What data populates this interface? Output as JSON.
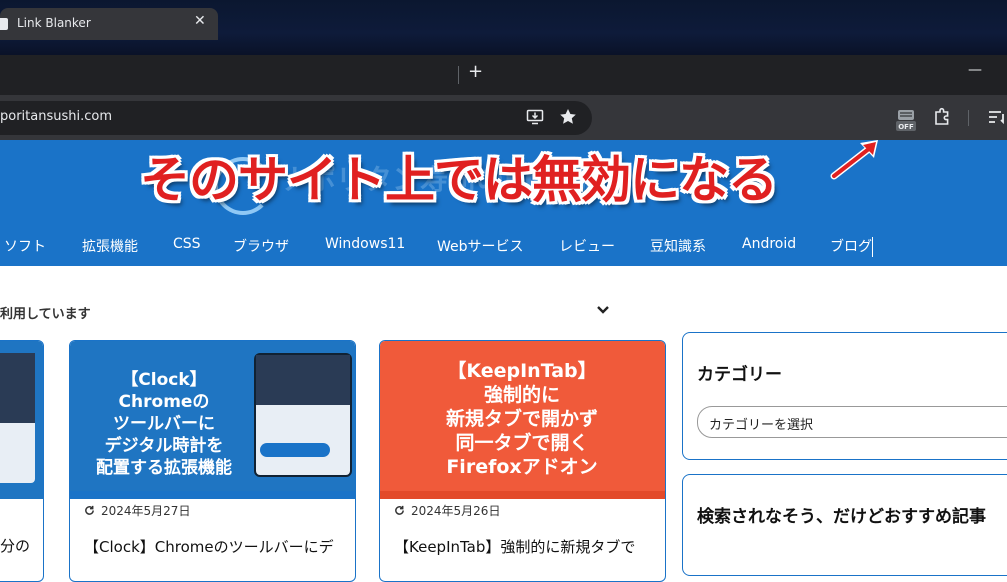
{
  "browser": {
    "tab": {
      "title": "Link Blanker",
      "close": "✕"
    },
    "new_tab": "+",
    "minimize": "—",
    "url": "poritansushi.com"
  },
  "overlay_caption": "そのサイト上では無効になる",
  "site": {
    "faded_name": "ナポリタン寿司のPC日記",
    "nav": [
      "ソフト",
      "拡張機能",
      "CSS",
      "ブラウザ",
      "Windows11",
      "Webサービス",
      "レビュー",
      "豆知識系",
      "Android",
      "ブログ"
    ]
  },
  "notice": "利用しています",
  "posts": [
    {
      "image_text": "【Clock】\nChromeの\nツールバーに\nデジタル時計を\n配置する拡張機能",
      "date": "2024年5月27日",
      "title": "【Clock】Chromeのツールバーにデ"
    },
    {
      "image_text": "【KeepInTab】\n強制的に\n新規タブで開かず\n同一タブで開く\nFirefoxアドオン",
      "date": "2024年5月26日",
      "title": "【KeepInTab】強制的に新規タブで"
    }
  ],
  "left_post_fragment": "分の",
  "sidebar": {
    "category_title": "カテゴリー",
    "category_select": "カテゴリーを選択",
    "recommend_title": "検索されなそう、だけどおすすめ記事"
  },
  "colors": {
    "accent": "#1a73c8",
    "caption": "#e02020"
  }
}
